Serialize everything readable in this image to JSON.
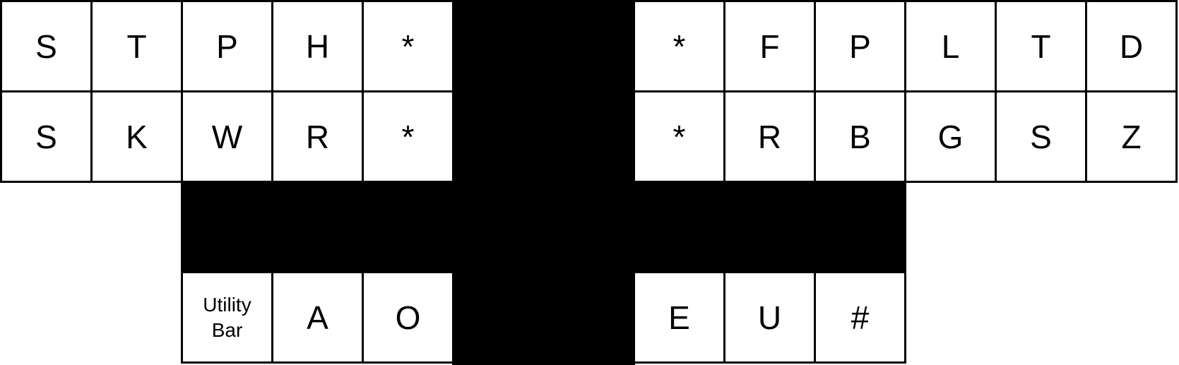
{
  "colors": {
    "key_fill": "#ffffff",
    "outline": "#000000",
    "blocked_area": "#000000"
  },
  "left_bank": {
    "top_row": [
      "S",
      "T",
      "P",
      "H",
      "*"
    ],
    "bottom_row": [
      "S",
      "K",
      "W",
      "R",
      "*"
    ]
  },
  "right_bank": {
    "top_row": [
      "*",
      "F",
      "P",
      "L",
      "T",
      "D"
    ],
    "bottom_row": [
      "*",
      "R",
      "B",
      "G",
      "S",
      "Z"
    ]
  },
  "thumbs": {
    "left": {
      "utility_line1": "Utility",
      "utility_line2": "Bar",
      "keys": [
        "A",
        "O"
      ]
    },
    "right": [
      "E",
      "U",
      "#"
    ]
  }
}
